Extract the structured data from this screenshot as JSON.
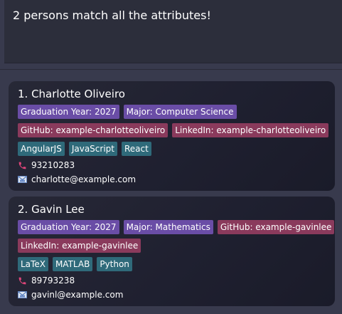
{
  "result": {
    "text": "2 persons match all the attributes!"
  },
  "persons": [
    {
      "name": "1. Charlotte Oliveiro",
      "rows": [
        [
          {
            "label": "Graduation Year: 2027",
            "color": "purple"
          },
          {
            "label": "Major: Computer Science",
            "color": "purple"
          }
        ],
        [
          {
            "label": "GitHub: example-charlotteoliveiro",
            "color": "red"
          },
          {
            "label": "LinkedIn: example-charlotteoliveiro",
            "color": "red"
          }
        ],
        [
          {
            "label": "AngularJS",
            "color": "teal"
          },
          {
            "label": "JavaScript",
            "color": "teal"
          },
          {
            "label": "React",
            "color": "teal"
          }
        ]
      ],
      "phone": "93210283",
      "email": "charlotte@example.com"
    },
    {
      "name": "2. Gavin Lee",
      "rows": [
        [
          {
            "label": "Graduation Year: 2027",
            "color": "purple"
          },
          {
            "label": "Major: Mathematics",
            "color": "purple"
          },
          {
            "label": "GitHub: example-gavinlee",
            "color": "red"
          }
        ],
        [
          {
            "label": "LinkedIn: example-gavinlee",
            "color": "red"
          }
        ],
        [
          {
            "label": "LaTeX",
            "color": "teal"
          },
          {
            "label": "MATLAB",
            "color": "teal"
          },
          {
            "label": "Python",
            "color": "teal"
          }
        ]
      ],
      "phone": "89793238",
      "email": "gavinl@example.com"
    }
  ],
  "icons": {
    "phone": "phone-icon",
    "email": "mail-icon"
  },
  "colors": {
    "purple": "#6a4da6",
    "red": "#8a3a5c",
    "teal": "#2f6a7a",
    "phone_icon": "#e0457a"
  }
}
